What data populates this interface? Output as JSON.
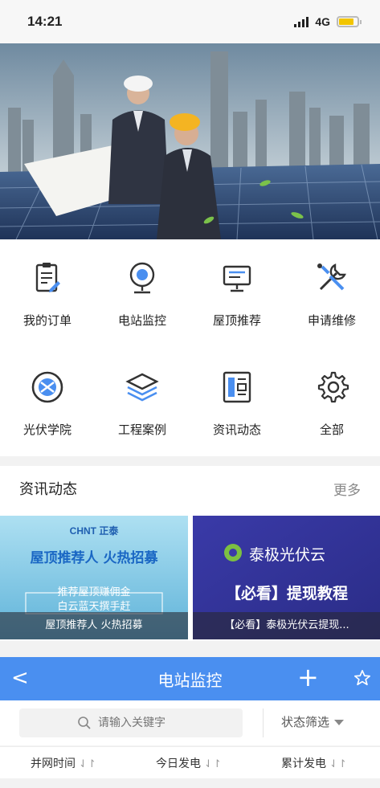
{
  "status": {
    "time": "14:21",
    "network": "4G"
  },
  "grid": {
    "items": [
      {
        "label": "我的订单",
        "icon": "clipboard-icon"
      },
      {
        "label": "电站监控",
        "icon": "camera-icon"
      },
      {
        "label": "屋顶推荐",
        "icon": "monitor-icon"
      },
      {
        "label": "申请维修",
        "icon": "tools-icon"
      },
      {
        "label": "光伏学院",
        "icon": "academy-icon"
      },
      {
        "label": "工程案例",
        "icon": "layers-icon"
      },
      {
        "label": "资讯动态",
        "icon": "news-icon"
      },
      {
        "label": "全部",
        "icon": "gear-icon"
      }
    ]
  },
  "news": {
    "title": "资讯动态",
    "more": "更多",
    "cards": [
      {
        "brand": "CHNT 正泰",
        "headline": "屋顶推荐人 火热招募",
        "sub1": "推荐屋顶赚佣金",
        "sub2": "白云蓝天撰手赶",
        "caption": "屋顶推荐人 火热招募"
      },
      {
        "brand": "泰极光伏云",
        "headline": "【必看】提现教程",
        "caption": "【必看】泰极光伏云提现..."
      }
    ]
  },
  "nav": {
    "back": "<",
    "title": "电站监控",
    "add": "+"
  },
  "search": {
    "placeholder": "请输入关键字",
    "filter": "状态筛选"
  },
  "sort": [
    {
      "label": "并网时间",
      "arrow": "⇃↾"
    },
    {
      "label": "今日发电",
      "arrow": "⇃↾"
    },
    {
      "label": "累计发电",
      "arrow": "⇃↾"
    }
  ]
}
